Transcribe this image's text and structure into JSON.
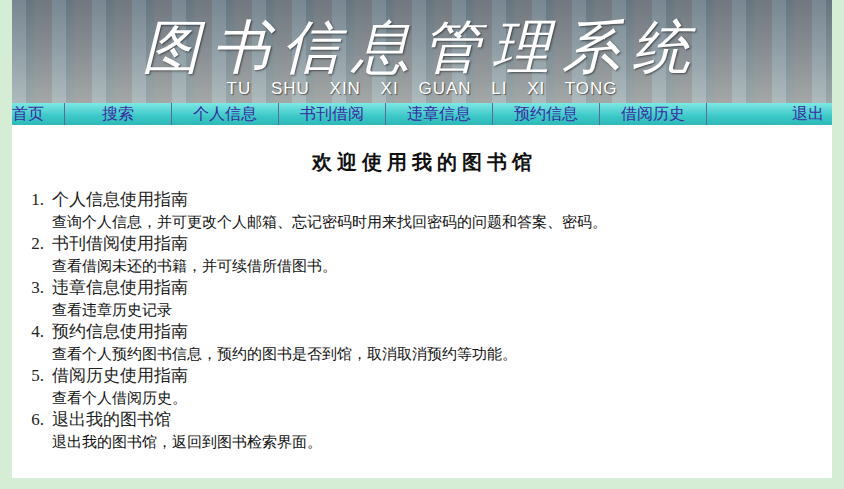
{
  "banner": {
    "title": "图书信息管理系统",
    "subtitle": "TU SHU XIN XI GUAN LI XI TONG"
  },
  "nav": {
    "items": [
      {
        "label": "首页",
        "selected": false
      },
      {
        "label": "搜索",
        "selected": false
      },
      {
        "label": "个人信息",
        "selected": false
      },
      {
        "label": "书刊借阅",
        "selected": false
      },
      {
        "label": "违章信息",
        "selected": false
      },
      {
        "label": "预约信息",
        "selected": false
      },
      {
        "label": "借阅历史",
        "selected": false
      }
    ],
    "logout": "退出"
  },
  "content": {
    "title": "欢 迎 使 用 我 的 图 书 馆",
    "guides": [
      {
        "number": "1.",
        "title": "个人信息使用指南",
        "description": "查询个人信息，并可更改个人邮箱、忘记密码时用来找回密码的问题和答案、密码。"
      },
      {
        "number": "2.",
        "title": "书刊借阅使用指南",
        "description": "查看借阅未还的书籍，并可续借所借图书。"
      },
      {
        "number": "3.",
        "title": "违章信息使用指南",
        "description": "查看违章历史记录"
      },
      {
        "number": "4.",
        "title": "预约信息使用指南",
        "description": "查看个人预约图书信息，预约的图书是否到馆，取消取消预约等功能。"
      },
      {
        "number": "5.",
        "title": "借阅历史使用指南",
        "description": "查看个人借阅历史。"
      },
      {
        "number": "6.",
        "title": "退出我的图书馆",
        "description": "退出我的图书馆，返回到图书检索界面。"
      }
    ]
  }
}
